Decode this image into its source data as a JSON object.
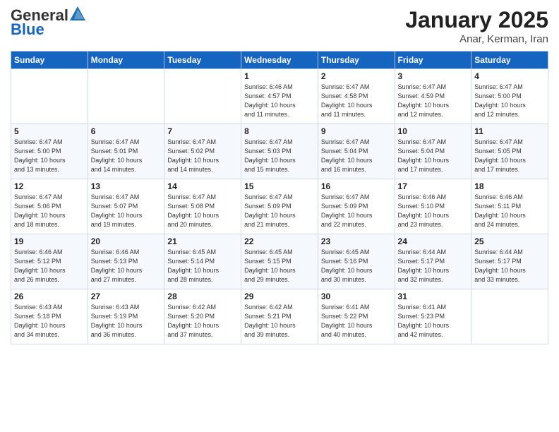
{
  "logo": {
    "general": "General",
    "blue": "Blue"
  },
  "title": "January 2025",
  "subtitle": "Anar, Kerman, Iran",
  "days_header": [
    "Sunday",
    "Monday",
    "Tuesday",
    "Wednesday",
    "Thursday",
    "Friday",
    "Saturday"
  ],
  "weeks": [
    [
      {
        "num": "",
        "info": ""
      },
      {
        "num": "",
        "info": ""
      },
      {
        "num": "",
        "info": ""
      },
      {
        "num": "1",
        "info": "Sunrise: 6:46 AM\nSunset: 4:57 PM\nDaylight: 10 hours\nand 11 minutes."
      },
      {
        "num": "2",
        "info": "Sunrise: 6:47 AM\nSunset: 4:58 PM\nDaylight: 10 hours\nand 11 minutes."
      },
      {
        "num": "3",
        "info": "Sunrise: 6:47 AM\nSunset: 4:59 PM\nDaylight: 10 hours\nand 12 minutes."
      },
      {
        "num": "4",
        "info": "Sunrise: 6:47 AM\nSunset: 5:00 PM\nDaylight: 10 hours\nand 12 minutes."
      }
    ],
    [
      {
        "num": "5",
        "info": "Sunrise: 6:47 AM\nSunset: 5:00 PM\nDaylight: 10 hours\nand 13 minutes."
      },
      {
        "num": "6",
        "info": "Sunrise: 6:47 AM\nSunset: 5:01 PM\nDaylight: 10 hours\nand 14 minutes."
      },
      {
        "num": "7",
        "info": "Sunrise: 6:47 AM\nSunset: 5:02 PM\nDaylight: 10 hours\nand 14 minutes."
      },
      {
        "num": "8",
        "info": "Sunrise: 6:47 AM\nSunset: 5:03 PM\nDaylight: 10 hours\nand 15 minutes."
      },
      {
        "num": "9",
        "info": "Sunrise: 6:47 AM\nSunset: 5:04 PM\nDaylight: 10 hours\nand 16 minutes."
      },
      {
        "num": "10",
        "info": "Sunrise: 6:47 AM\nSunset: 5:04 PM\nDaylight: 10 hours\nand 17 minutes."
      },
      {
        "num": "11",
        "info": "Sunrise: 6:47 AM\nSunset: 5:05 PM\nDaylight: 10 hours\nand 17 minutes."
      }
    ],
    [
      {
        "num": "12",
        "info": "Sunrise: 6:47 AM\nSunset: 5:06 PM\nDaylight: 10 hours\nand 18 minutes."
      },
      {
        "num": "13",
        "info": "Sunrise: 6:47 AM\nSunset: 5:07 PM\nDaylight: 10 hours\nand 19 minutes."
      },
      {
        "num": "14",
        "info": "Sunrise: 6:47 AM\nSunset: 5:08 PM\nDaylight: 10 hours\nand 20 minutes."
      },
      {
        "num": "15",
        "info": "Sunrise: 6:47 AM\nSunset: 5:09 PM\nDaylight: 10 hours\nand 21 minutes."
      },
      {
        "num": "16",
        "info": "Sunrise: 6:47 AM\nSunset: 5:09 PM\nDaylight: 10 hours\nand 22 minutes."
      },
      {
        "num": "17",
        "info": "Sunrise: 6:46 AM\nSunset: 5:10 PM\nDaylight: 10 hours\nand 23 minutes."
      },
      {
        "num": "18",
        "info": "Sunrise: 6:46 AM\nSunset: 5:11 PM\nDaylight: 10 hours\nand 24 minutes."
      }
    ],
    [
      {
        "num": "19",
        "info": "Sunrise: 6:46 AM\nSunset: 5:12 PM\nDaylight: 10 hours\nand 26 minutes."
      },
      {
        "num": "20",
        "info": "Sunrise: 6:46 AM\nSunset: 5:13 PM\nDaylight: 10 hours\nand 27 minutes."
      },
      {
        "num": "21",
        "info": "Sunrise: 6:45 AM\nSunset: 5:14 PM\nDaylight: 10 hours\nand 28 minutes."
      },
      {
        "num": "22",
        "info": "Sunrise: 6:45 AM\nSunset: 5:15 PM\nDaylight: 10 hours\nand 29 minutes."
      },
      {
        "num": "23",
        "info": "Sunrise: 6:45 AM\nSunset: 5:16 PM\nDaylight: 10 hours\nand 30 minutes."
      },
      {
        "num": "24",
        "info": "Sunrise: 6:44 AM\nSunset: 5:17 PM\nDaylight: 10 hours\nand 32 minutes."
      },
      {
        "num": "25",
        "info": "Sunrise: 6:44 AM\nSunset: 5:17 PM\nDaylight: 10 hours\nand 33 minutes."
      }
    ],
    [
      {
        "num": "26",
        "info": "Sunrise: 6:43 AM\nSunset: 5:18 PM\nDaylight: 10 hours\nand 34 minutes."
      },
      {
        "num": "27",
        "info": "Sunrise: 6:43 AM\nSunset: 5:19 PM\nDaylight: 10 hours\nand 36 minutes."
      },
      {
        "num": "28",
        "info": "Sunrise: 6:42 AM\nSunset: 5:20 PM\nDaylight: 10 hours\nand 37 minutes."
      },
      {
        "num": "29",
        "info": "Sunrise: 6:42 AM\nSunset: 5:21 PM\nDaylight: 10 hours\nand 39 minutes."
      },
      {
        "num": "30",
        "info": "Sunrise: 6:41 AM\nSunset: 5:22 PM\nDaylight: 10 hours\nand 40 minutes."
      },
      {
        "num": "31",
        "info": "Sunrise: 6:41 AM\nSunset: 5:23 PM\nDaylight: 10 hours\nand 42 minutes."
      },
      {
        "num": "",
        "info": ""
      }
    ]
  ]
}
